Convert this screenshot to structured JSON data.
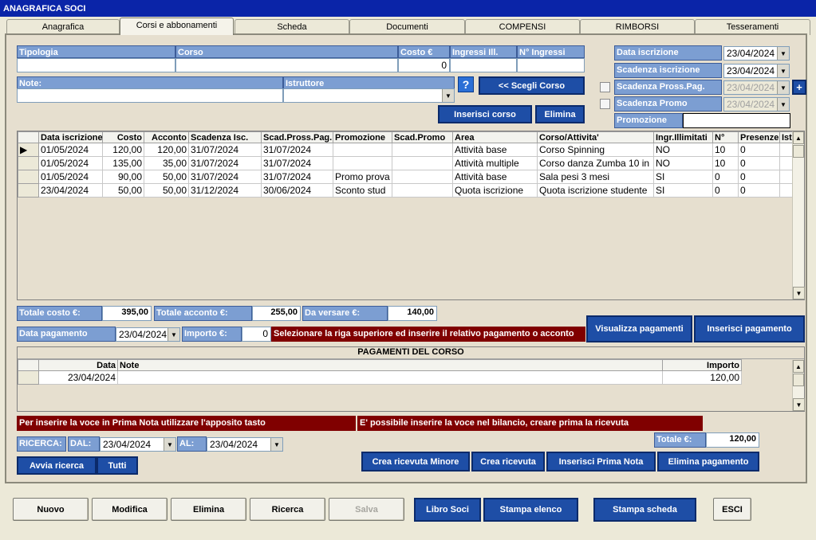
{
  "window": {
    "title": "ANAGRAFICA SOCI"
  },
  "tabs": [
    "Anagrafica",
    "Corsi e abbonamenti",
    "Scheda",
    "Documenti",
    "COMPENSI",
    "RIMBORSI",
    "Tesseramenti"
  ],
  "top_form": {
    "headers": {
      "tipologia": "Tipologia",
      "corso": "Corso",
      "costo": "Costo €",
      "ingressi_ill": "Ingressi Ill.",
      "n_ingressi": "N° Ingressi",
      "note": "Note:",
      "istruttore": "Istruttore"
    },
    "costo_value": "0",
    "help": "?",
    "scegli_corso": "<< Scegli Corso",
    "inserisci_corso": "Inserisci corso",
    "elimina": "Elimina"
  },
  "right_form": {
    "data_iscrizione_label": "Data iscrizione",
    "data_iscrizione": "23/04/2024",
    "scadenza_iscrizione_label": "Scadenza iscrizione",
    "scadenza_iscrizione": "23/04/2024",
    "scadenza_pross_label": "Scadenza Pross.Pag.",
    "scadenza_pross": "23/04/2024",
    "scadenza_promo_label": "Scadenza Promo",
    "scadenza_promo": "23/04/2024",
    "promozione_label": "Promozione",
    "plus": "+"
  },
  "courses_table": {
    "columns": [
      "Data iscrizione",
      "Costo",
      "Acconto",
      "Scadenza Isc.",
      "Scad.Pross.Pag.",
      "Promozione",
      "Scad.Promo",
      "Area",
      "Corso/Attivita'",
      "Ingr.Illimitati",
      "N°",
      "Presenze",
      "Ist"
    ],
    "rows": [
      [
        "01/05/2024",
        "120,00",
        "120,00",
        "31/07/2024",
        "31/07/2024",
        "",
        "",
        "Attività base",
        "Corso Spinning",
        "NO",
        "10",
        "0",
        ""
      ],
      [
        "01/05/2024",
        "135,00",
        "35,00",
        "31/07/2024",
        "31/07/2024",
        "",
        "",
        "Attività multiple",
        "Corso danza Zumba 10 in",
        "NO",
        "10",
        "0",
        ""
      ],
      [
        "01/05/2024",
        "90,00",
        "50,00",
        "31/07/2024",
        "31/07/2024",
        "Promo prova",
        "",
        "Attività base",
        "Sala pesi 3 mesi",
        "SI",
        "0",
        "0",
        ""
      ],
      [
        "23/04/2024",
        "50,00",
        "50,00",
        "31/12/2024",
        "30/06/2024",
        "Sconto stud",
        "",
        "Quota iscrizione",
        "Quota iscrizione studente",
        "SI",
        "0",
        "0",
        ""
      ]
    ]
  },
  "totals": {
    "totale_costo_label": "Totale costo €:",
    "totale_costo": "395,00",
    "totale_acconto_label": "Totale acconto €:",
    "totale_acconto": "255,00",
    "da_versare_label": "Da versare €:",
    "da_versare": "140,00"
  },
  "payment_entry": {
    "data_pagamento_label": "Data pagamento",
    "data_pagamento": "23/04/2024",
    "importo_label": "Importo €:",
    "importo": "0",
    "hint": "Selezionare la riga superiore ed inserire il relativo pagamento o acconto",
    "visualizza": "Visualizza pagamenti",
    "inserisci": "Inserisci pagamento"
  },
  "payments_table": {
    "title": "PAGAMENTI DEL CORSO",
    "columns": [
      "Data",
      "Note",
      "Importo"
    ],
    "rows": [
      [
        "23/04/2024",
        "",
        "120,00"
      ]
    ]
  },
  "messages": {
    "prima_nota": "Per inserire la voce in Prima Nota utilizzare l'apposito tasto",
    "bilancio": "E' possibile inserire la voce nel bilancio, creare prima la ricevuta"
  },
  "search": {
    "ricerca": "RICERCA:",
    "dal": "DAL:",
    "dal_value": "23/04/2024",
    "al": "AL:",
    "al_value": "23/04/2024",
    "avvia": "Avvia ricerca",
    "tutti": "Tutti"
  },
  "totale": {
    "label": "Totale €:",
    "value": "120,00"
  },
  "receipt_buttons": [
    "Crea ricevuta Minore",
    "Crea ricevuta",
    "Inserisci Prima Nota",
    "Elimina pagamento"
  ],
  "bottom_buttons": {
    "nuovo": "Nuovo",
    "modifica": "Modifica",
    "elimina": "Elimina",
    "ricerca": "Ricerca",
    "salva": "Salva",
    "libro_soci": "Libro Soci",
    "stampa_elenco": "Stampa elenco",
    "stampa_scheda": "Stampa scheda",
    "esci": "ESCI"
  }
}
